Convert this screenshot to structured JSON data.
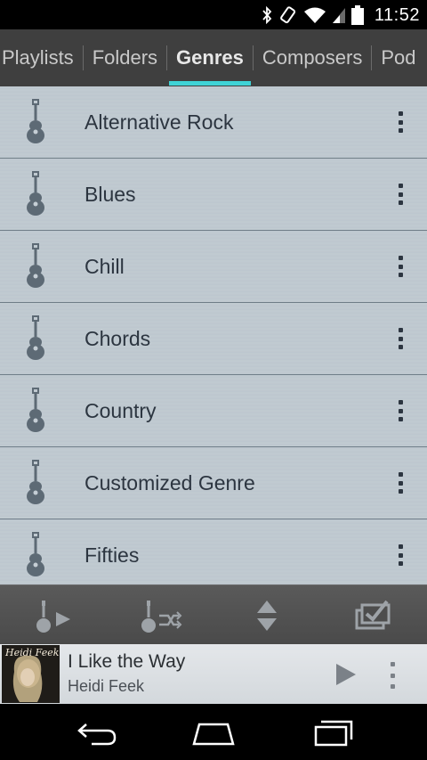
{
  "status_bar": {
    "time": "11:52",
    "icons": [
      "bluetooth-icon",
      "rotate-icon",
      "wifi-icon",
      "signal-icon",
      "battery-icon"
    ]
  },
  "tabs": [
    {
      "label": "Playlists",
      "active": false
    },
    {
      "label": "Folders",
      "active": false
    },
    {
      "label": "Genres",
      "active": true
    },
    {
      "label": "Composers",
      "active": false
    },
    {
      "label": "Pod",
      "active": false
    }
  ],
  "accent_color": "#3fd3d6",
  "genres": [
    {
      "label": "Alternative Rock",
      "icon": "guitar-icon"
    },
    {
      "label": "Blues",
      "icon": "guitar-icon"
    },
    {
      "label": "Chill",
      "icon": "guitar-icon"
    },
    {
      "label": "Chords",
      "icon": "guitar-icon"
    },
    {
      "label": "Country",
      "icon": "guitar-icon"
    },
    {
      "label": "Customized Genre",
      "icon": "guitar-icon"
    },
    {
      "label": "Fifties",
      "icon": "guitar-icon"
    }
  ],
  "action_bar": {
    "items": [
      "play-genres-icon",
      "shuffle-genres-icon",
      "sort-icon",
      "multi-select-icon"
    ]
  },
  "now_playing": {
    "title": "I Like the Way",
    "artist": "Heidi Feek",
    "album_art_text": "Heidi Feek"
  },
  "nav_bar": {
    "items": [
      "back-icon",
      "home-icon",
      "recents-icon"
    ]
  }
}
